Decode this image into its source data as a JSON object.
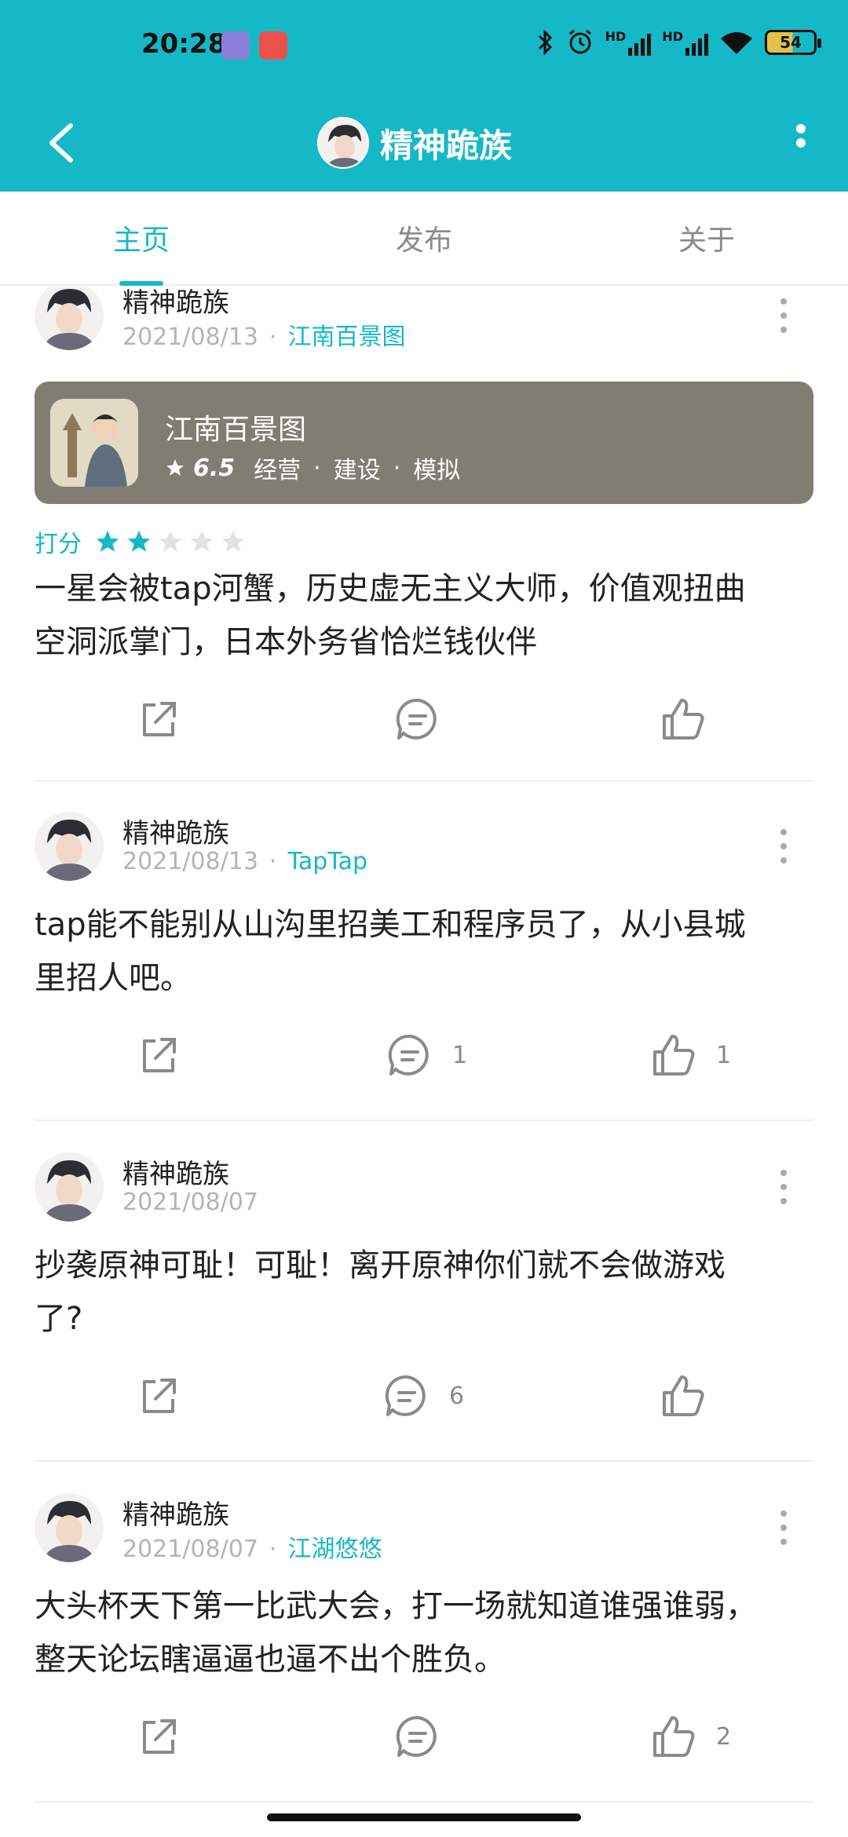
{
  "status": {
    "time": "20:28",
    "battery": "54",
    "hd": "HD"
  },
  "header": {
    "back_icon": "back-arrow-icon",
    "title": "精神跪族",
    "more_icon": "more-vertical-icon"
  },
  "tabs": [
    {
      "label": "主页",
      "active": true
    },
    {
      "label": "发布",
      "active": false
    },
    {
      "label": "关于",
      "active": false
    }
  ],
  "posts": [
    {
      "author": "精神跪族",
      "date": "2021/08/13",
      "tag": "江南百景图",
      "game": {
        "title": "江南百景图",
        "score": "6.5",
        "genres": [
          "经营",
          "建设",
          "模拟"
        ]
      },
      "rating_label": "打分",
      "rating": 2,
      "text_lines": [
        "一星会被tap河蟹，历史虚无主义大师，价值观扭曲",
        "空洞派掌门，日本外务省恰烂钱伙伴"
      ],
      "comments": "",
      "likes": ""
    },
    {
      "author": "精神跪族",
      "date": "2021/08/13",
      "tag": "TapTap",
      "text_lines": [
        "tap能不能别从山沟里招美工和程序员了，从小县城",
        "里招人吧。"
      ],
      "comments": "1",
      "likes": "1"
    },
    {
      "author": "精神跪族",
      "date": "2021/08/07",
      "tag": "",
      "text_lines": [
        "抄袭原神可耻！可耻！离开原神你们就不会做游戏",
        "了?"
      ],
      "comments": "6",
      "likes": ""
    },
    {
      "author": "精神跪族",
      "date": "2021/08/07",
      "tag": "江湖悠悠",
      "text_lines": [
        "大头杯天下第一比武大会，打一场就知道谁强谁弱，",
        "整天论坛瞎逼逼也逼不出个胜负。"
      ],
      "comments": "",
      "likes": "2"
    }
  ],
  "colors": {
    "accent": "#15b8c6",
    "card": "#807d73"
  }
}
